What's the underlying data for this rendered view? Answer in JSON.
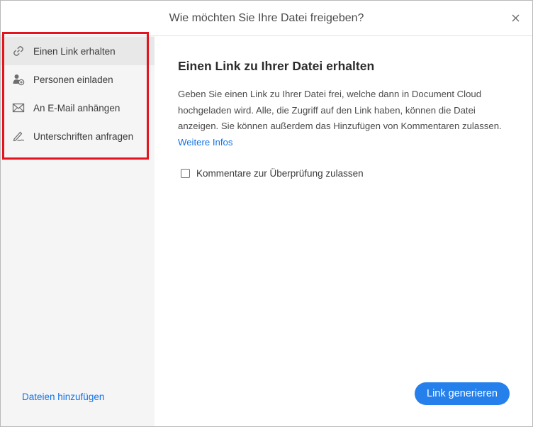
{
  "dialog": {
    "title": "Wie möchten Sie Ihre Datei freigeben?",
    "close_icon": "close-icon"
  },
  "sidebar": {
    "items": [
      {
        "label": "Einen Link erhalten",
        "icon": "link-icon",
        "active": true
      },
      {
        "label": "Personen einladen",
        "icon": "person-add-icon",
        "active": false
      },
      {
        "label": "An E-Mail anhängen",
        "icon": "envelope-icon",
        "active": false
      },
      {
        "label": "Unterschriften anfragen",
        "icon": "signature-pen-icon",
        "active": false
      }
    ],
    "add_files": "Dateien hinzufügen"
  },
  "main": {
    "title": "Einen Link zu Ihrer Datei erhalten",
    "description": "Geben Sie einen Link zu Ihrer Datei frei, welche dann in Document Cloud hochgeladen wird. Alle, die Zugriff auf den Link haben, können die Datei anzeigen. Sie können außerdem das Hinzufügen von Kommentaren zulassen.",
    "learn_more": "Weitere Infos",
    "checkbox_label": "Kommentare zur Überprüfung zulassen",
    "checkbox_checked": false,
    "primary_button": "Link generieren"
  },
  "colors": {
    "accent": "#1473e6",
    "button": "#2680eb",
    "highlight": "#e3141d",
    "sidebar_bg": "#f5f5f5"
  }
}
